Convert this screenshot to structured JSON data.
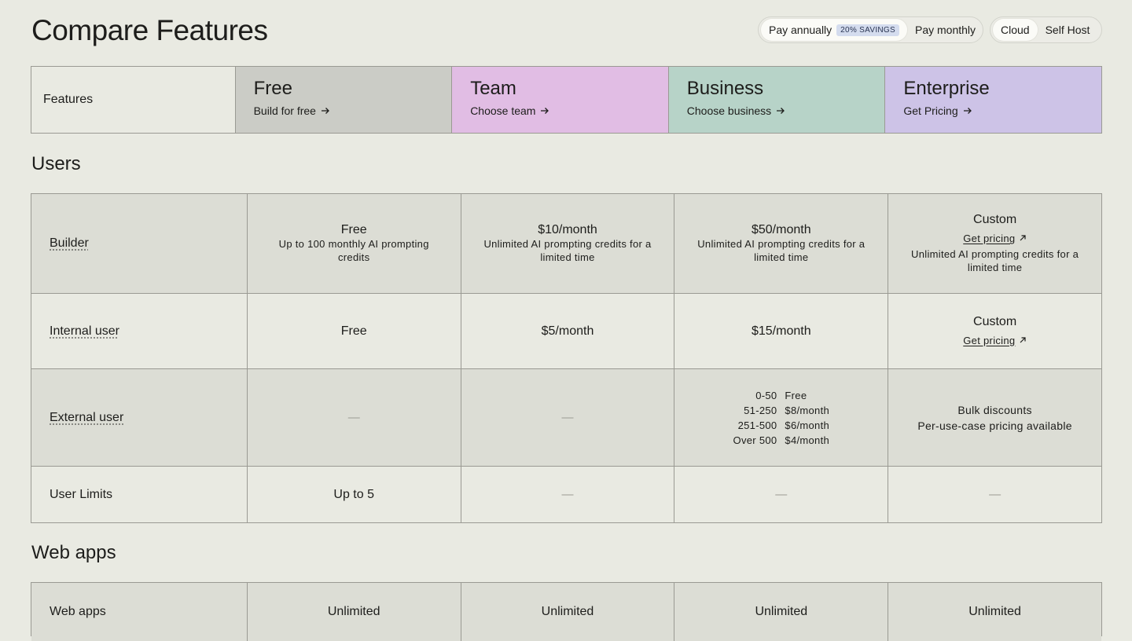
{
  "page_title": "Compare Features",
  "billing_toggle": {
    "annual": "Pay annually",
    "savings": "20% SAVINGS",
    "monthly": "Pay monthly"
  },
  "deploy_toggle": {
    "cloud": "Cloud",
    "self_host": "Self Host"
  },
  "header": {
    "features_label": "Features",
    "plans": [
      {
        "name": "Free",
        "link": "Build for free",
        "color": "#cbccc6"
      },
      {
        "name": "Team",
        "link": "Choose team",
        "color": "#e1bde4"
      },
      {
        "name": "Business",
        "link": "Choose business",
        "color": "#b7d3c8"
      },
      {
        "name": "Enterprise",
        "link": "Get Pricing",
        "color": "#cdc3e7"
      }
    ]
  },
  "sections": {
    "users": {
      "title": "Users",
      "rows": {
        "builder": {
          "label": "Builder",
          "free": {
            "value": "Free",
            "sub": "Up to 100 monthly AI prompting credits"
          },
          "team": {
            "value": "$10/month",
            "sub": "Unlimited AI prompting credits for a limited time"
          },
          "business": {
            "value": "$50/month",
            "sub": "Unlimited AI prompting credits for a limited time"
          },
          "enterprise": {
            "value": "Custom",
            "link": "Get pricing",
            "sub": "Unlimited AI prompting credits for a limited time"
          }
        },
        "internal": {
          "label": "Internal user",
          "free": "Free",
          "team": "$5/month",
          "business": "$15/month",
          "enterprise": {
            "value": "Custom",
            "link": "Get pricing"
          }
        },
        "external": {
          "label": "External user",
          "free": "—",
          "team": "—",
          "business_tiers": [
            {
              "range": "0-50",
              "price": "Free"
            },
            {
              "range": "51-250",
              "price": "$8/month"
            },
            {
              "range": "251-500",
              "price": "$6/month"
            },
            {
              "range": "Over 500",
              "price": "$4/month"
            }
          ],
          "enterprise": {
            "line1": "Bulk discounts",
            "line2": "Per-use-case pricing available"
          }
        },
        "limits": {
          "label": "User Limits",
          "free": "Up to 5",
          "team": "—",
          "business": "—",
          "enterprise": "—"
        }
      }
    },
    "web_apps": {
      "title": "Web apps",
      "rows": {
        "web_apps": {
          "label": "Web apps",
          "free": "Unlimited",
          "team": "Unlimited",
          "business": "Unlimited",
          "enterprise": "Unlimited"
        }
      }
    }
  }
}
